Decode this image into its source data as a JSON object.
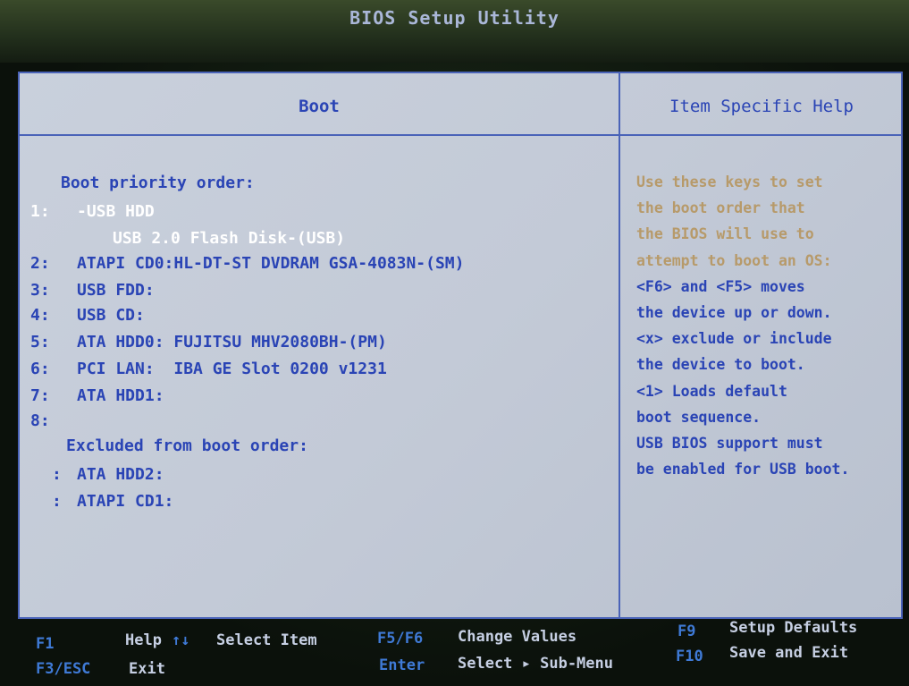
{
  "title": "BIOS Setup Utility",
  "tab": "Boot",
  "help_header": "Item Specific Help",
  "boot_priority_label": "Boot priority order:",
  "boot_items": [
    {
      "num": "1:",
      "text": "-USB HDD",
      "selected": true
    },
    {
      "num": "",
      "text": "USB 2.0 Flash Disk-(USB)",
      "selected": true
    },
    {
      "num": "2:",
      "text": "ATAPI CD0:HL-DT-ST DVDRAM GSA-4083N-(SM)"
    },
    {
      "num": "3:",
      "text": "USB FDD:"
    },
    {
      "num": "4:",
      "text": "USB CD:"
    },
    {
      "num": "5:",
      "text": "ATA HDD0: FUJITSU MHV2080BH-(PM)"
    },
    {
      "num": "6:",
      "text": "PCI LAN:  IBA GE Slot 0200 v1231"
    },
    {
      "num": "7:",
      "text": "ATA HDD1:"
    },
    {
      "num": "8:",
      "text": ""
    }
  ],
  "excluded_label": "Excluded from boot order:",
  "excluded_items": [
    {
      "num": ":",
      "text": "ATA HDD2:"
    },
    {
      "num": ":",
      "text": "ATAPI CD1:"
    }
  ],
  "help_lines": [
    {
      "text": "Use these keys to set",
      "highlight": true
    },
    {
      "text": "the boot order that",
      "highlight": true
    },
    {
      "text": "the BIOS will use to",
      "highlight": true
    },
    {
      "text": "attempt to boot an OS:",
      "highlight": true
    },
    {
      "text": "<F6> and <F5> moves"
    },
    {
      "text": "the device up or down."
    },
    {
      "text": "<x> exclude or include"
    },
    {
      "text": "the device to boot."
    },
    {
      "text": "<1> Loads default"
    },
    {
      "text": "boot sequence."
    },
    {
      "text": "USB BIOS support must"
    },
    {
      "text": "be enabled for USB boot."
    }
  ],
  "footer": {
    "f1_key": "F1",
    "f1_label": "Help",
    "arrows_key": "↑↓",
    "arrows_label": "Select Item",
    "esc_key": "F3/ESC",
    "esc_label": "Exit",
    "f5f6_key": "F5/F6",
    "f5f6_label": "Change Values",
    "enter_key": "Enter",
    "enter_label": "Select ▸ Sub-Menu",
    "f9_key": "F9",
    "f9_label": "Setup Defaults",
    "f10_key": "F10",
    "f10_label": "Save and Exit"
  }
}
